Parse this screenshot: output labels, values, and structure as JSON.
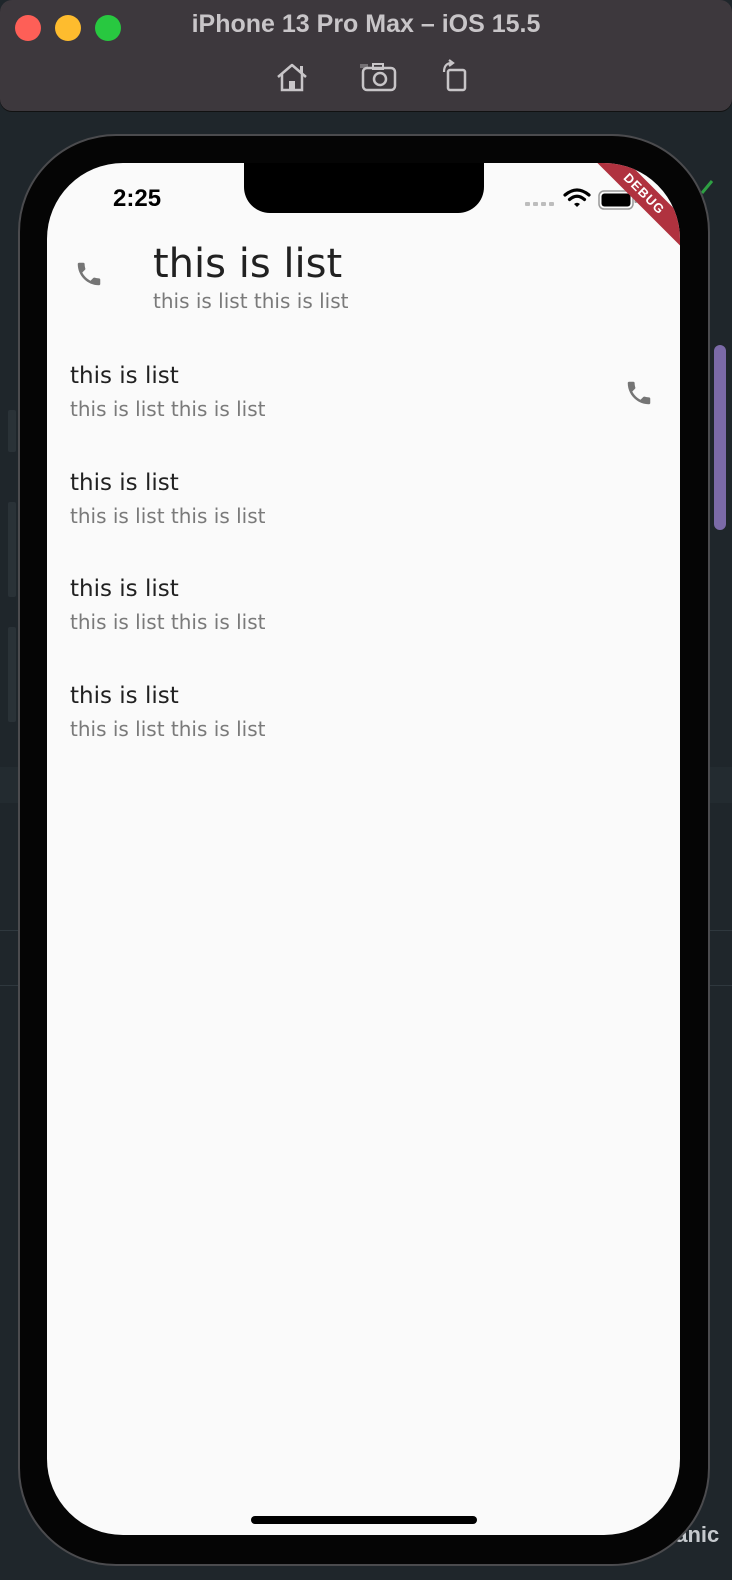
{
  "window": {
    "title": "iPhone 13 Pro Max – iOS 15.5",
    "toolbar": [
      "home-icon",
      "screenshot-icon",
      "rotate-icon"
    ]
  },
  "status_bar": {
    "time": "2:25",
    "icons": [
      "cellular-signal-icon",
      "wifi-icon",
      "battery-icon"
    ]
  },
  "debug_banner": "DEBUG",
  "list": {
    "items": [
      {
        "title": "this is list",
        "subtitle": "this is list this is list",
        "icon": "phone-icon",
        "icon_position": "leading"
      },
      {
        "title": "this is list",
        "subtitle": "this is list this is list",
        "icon": "phone-icon",
        "icon_position": "trailing"
      },
      {
        "title": "this is list",
        "subtitle": "this is list this is list"
      },
      {
        "title": "this is list",
        "subtitle": "this is list this is list"
      },
      {
        "title": "this is list",
        "subtitle": "this is list this is list"
      }
    ]
  },
  "background": {
    "partial_label": "eanic"
  },
  "colors": {
    "screen_bg": "#fafafa",
    "title_text": "#212121",
    "subtitle_text": "#7a7a7a",
    "icon": "#757575",
    "debug_ribbon": "#b0323f"
  }
}
